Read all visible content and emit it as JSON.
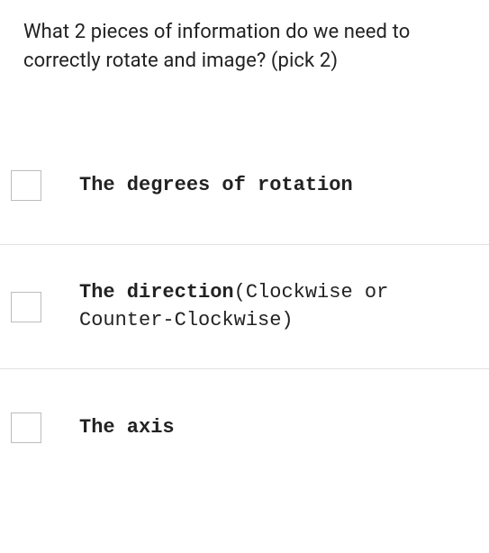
{
  "question": {
    "text": "What 2 pieces of information do we need to correctly rotate and image? (pick 2)"
  },
  "options": [
    {
      "bold": "The degrees of rotation",
      "regular": ""
    },
    {
      "bold": "The direction",
      "regular": "(Clockwise or Counter-Clockwise)"
    },
    {
      "bold": "The axis",
      "regular": ""
    }
  ]
}
